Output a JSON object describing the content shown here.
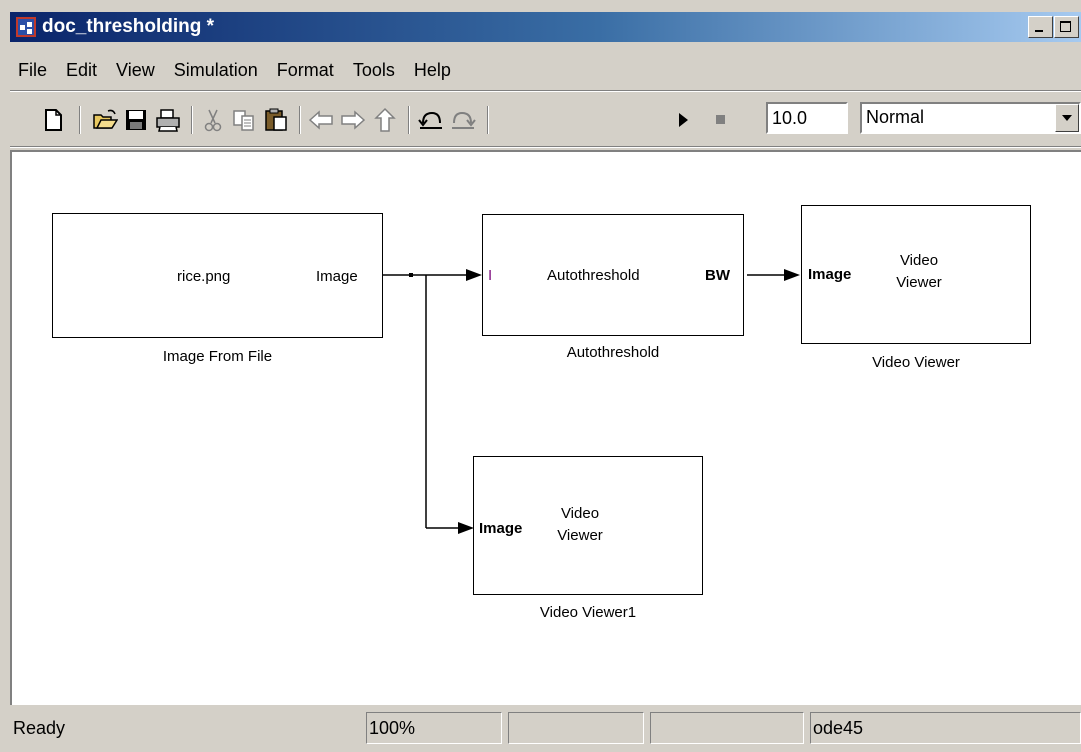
{
  "window": {
    "title": "doc_thresholding *"
  },
  "menu": [
    "File",
    "Edit",
    "View",
    "Simulation",
    "Format",
    "Tools",
    "Help"
  ],
  "toolbar": {
    "buttons": [
      "new-model-icon",
      "open-icon",
      "save-icon",
      "print-icon",
      "cut-icon",
      "copy-icon",
      "paste-icon",
      "back-icon",
      "forward-icon",
      "up-icon",
      "undo-icon",
      "redo-icon",
      "start-simulation-icon",
      "stop-simulation-icon"
    ],
    "stop_time": "10.0",
    "simulation_mode": "Normal"
  },
  "diagram": {
    "blocks": {
      "image_from_file": {
        "content": "rice.png",
        "port_out": "Image",
        "name": "Image From File"
      },
      "autothreshold": {
        "port_in": "I",
        "content": "Autothreshold",
        "port_out": "BW",
        "name": "Autothreshold"
      },
      "video_viewer": {
        "port_in": "Image",
        "content_line1": "Video",
        "content_line2": "Viewer",
        "name": "Video Viewer"
      },
      "video_viewer1": {
        "port_in": "Image",
        "content_line1": "Video",
        "content_line2": "Viewer",
        "name": "Video Viewer1"
      }
    }
  },
  "status": {
    "message": "Ready",
    "zoom": "100%",
    "pane3": "",
    "pane4": "",
    "solver": "ode45"
  }
}
